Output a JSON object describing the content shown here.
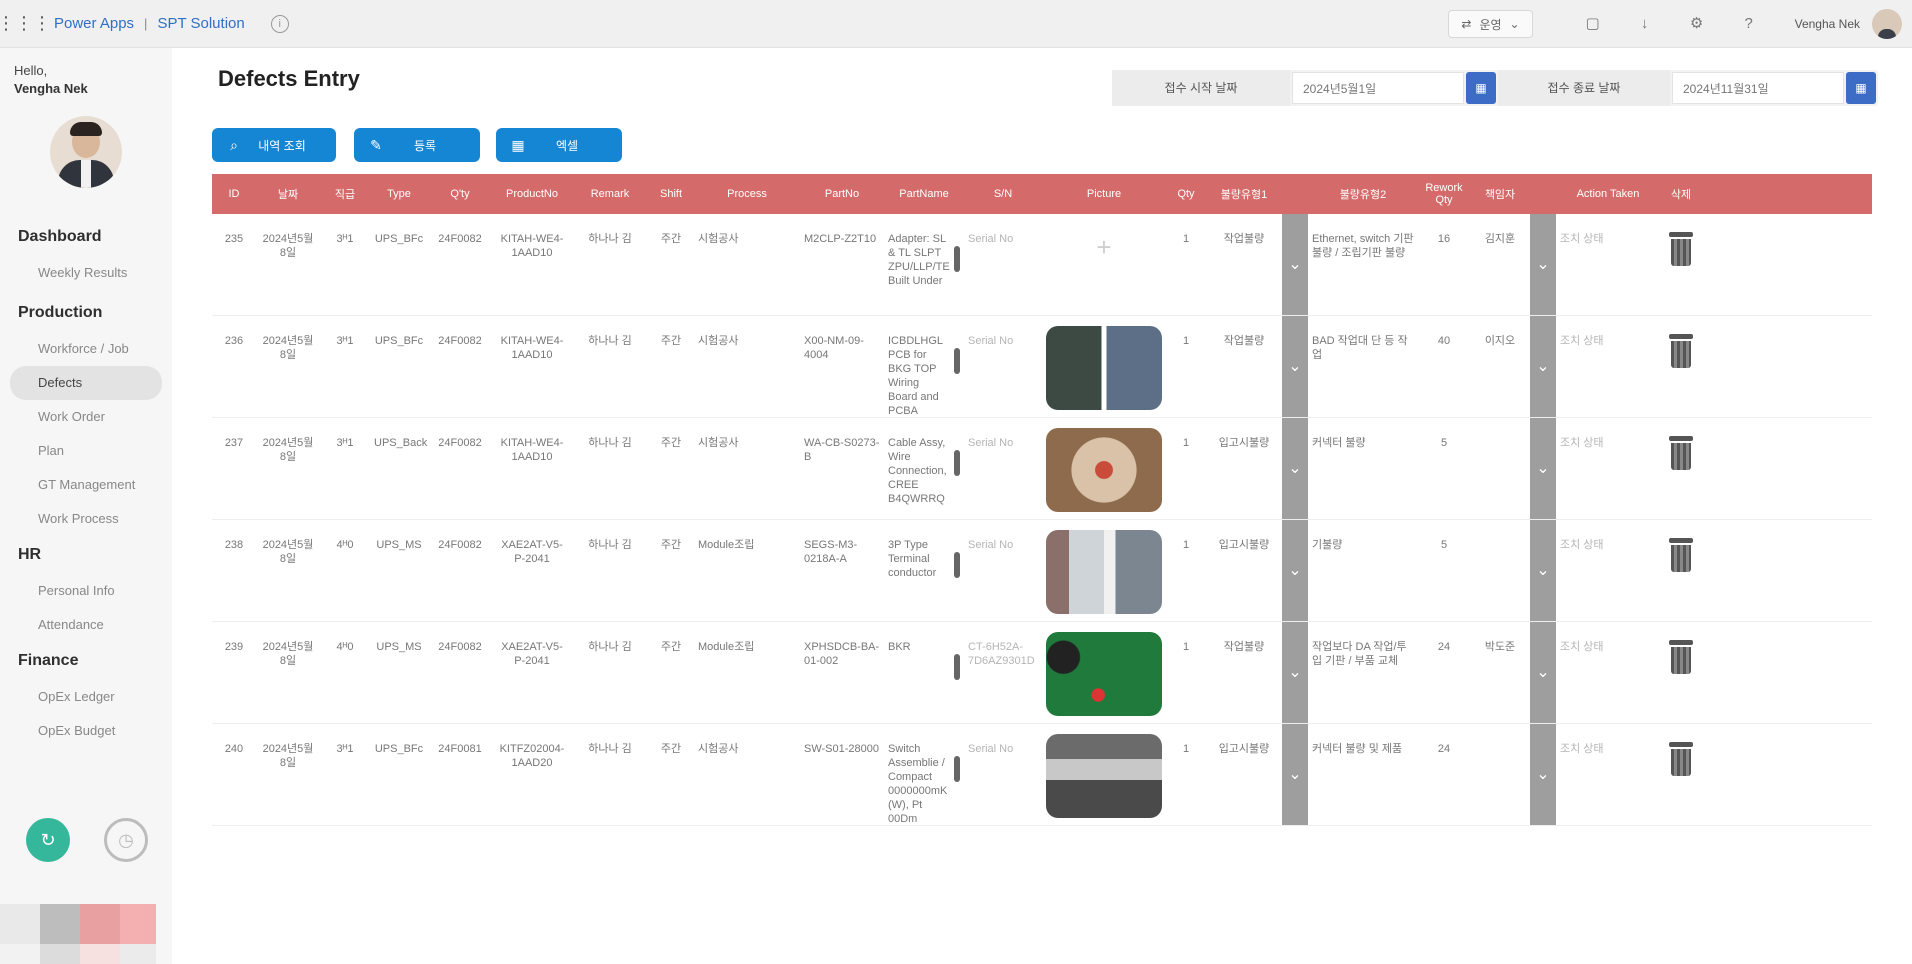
{
  "topbar": {
    "app_title": "Power Apps",
    "separator": "|",
    "solution_name": "SPT Solution",
    "environment": "운영",
    "user_name": "Vengha Nek"
  },
  "sidebar": {
    "greeting": "Hello,",
    "user_name": "Vengha Nek",
    "sections": [
      {
        "title": "Dashboard",
        "items": [
          "Weekly Results"
        ]
      },
      {
        "title": "Production",
        "items": [
          "Workforce / Job",
          "Defects",
          "Work Order",
          "Plan",
          "GT Management",
          "Work Process"
        ]
      },
      {
        "title": "HR",
        "items": [
          "Personal Info",
          "Attendance"
        ]
      },
      {
        "title": "Finance",
        "items": [
          "OpEx Ledger",
          "OpEx Budget"
        ]
      }
    ],
    "active_item": "Defects"
  },
  "page": {
    "title": "Defects Entry",
    "start_date_label": "접수 시작 날짜",
    "start_date_value": "2024년5월1일",
    "end_date_label": "접수 종료 날짜",
    "end_date_value": "2024년11월31일",
    "buttons": {
      "search": "내역 조회",
      "register": "등록",
      "excel": "엑셀"
    }
  },
  "table": {
    "columns": [
      "ID",
      "날짜",
      "직급",
      "Type",
      "Q'ty",
      "ProductNo",
      "Remark",
      "Shift",
      "Process",
      "PartNo",
      "PartName",
      "S/N",
      "Picture",
      "Qty",
      "불량유형1",
      "",
      "불량유형2",
      "Rework Qty",
      "책임자",
      "",
      "Action Taken",
      "삭제"
    ],
    "rows": [
      {
        "id": "235",
        "date": "2024년5월8일",
        "grade": "3ᴴ1",
        "type": "UPS_BFc",
        "qty": "24F0082",
        "product_no": "KITAH-WE4-1AAD10",
        "remark": "하나나 김",
        "shift": "주간",
        "process": "시험공사",
        "part_no": "M2CLP-Z2T10",
        "part_name": "Adapter: SL & TL SLPT ZPU/LLP/TEST/Scale-Built Under",
        "sn": "Serial No",
        "picture": "",
        "count": "1",
        "defect1": "작업불량",
        "defect2": "Ethernet, switch 기판 불량 / 조립기판 불량",
        "rework": "16",
        "owner": "김지훈",
        "action": "조치 상태"
      },
      {
        "id": "236",
        "date": "2024년5월8일",
        "grade": "3ᴴ1",
        "type": "UPS_BFc",
        "qty": "24F0082",
        "product_no": "KITAH-WE4-1AAD10",
        "remark": "하나나 김",
        "shift": "주간",
        "process": "시험공사",
        "part_no": "X00-NM-09-4004",
        "part_name": "ICBDLHGL PCB for BKG TOP Wiring Board and PCBA",
        "sn": "Serial No",
        "picture": "photo1",
        "count": "1",
        "defect1": "작업불량",
        "defect2": "BAD 작업대 단 등 작업",
        "rework": "40",
        "owner": "이지오",
        "action": "조치 상태"
      },
      {
        "id": "237",
        "date": "2024년5월8일",
        "grade": "3ᴴ1",
        "type": "UPS_Back",
        "qty": "24F0082",
        "product_no": "KITAH-WE4-1AAD10",
        "remark": "하나나 김",
        "shift": "주간",
        "process": "시험공사",
        "part_no": "WA-CB-S0273-B",
        "part_name": "Cable Assy, Wire Connection, CREE B4QWRRQ",
        "sn": "Serial No",
        "picture": "photo2",
        "count": "1",
        "defect1": "입고시불량",
        "defect2": "커넥터 불량",
        "rework": "5",
        "owner": "",
        "action": "조치 상태"
      },
      {
        "id": "238",
        "date": "2024년5월8일",
        "grade": "4ᴴ0",
        "type": "UPS_MS",
        "qty": "24F0082",
        "product_no": "XAE2AT-V5-P-2041",
        "remark": "하나나 김",
        "shift": "주간",
        "process": "Module조립",
        "part_no": "SEGS-M3-0218A-A",
        "part_name": "3P Type Terminal conductor",
        "sn": "Serial No",
        "picture": "photo3",
        "count": "1",
        "defect1": "입고시불량",
        "defect2": "기불량",
        "rework": "5",
        "owner": "",
        "action": "조치 상태"
      },
      {
        "id": "239",
        "date": "2024년5월8일",
        "grade": "4ᴴ0",
        "type": "UPS_MS",
        "qty": "24F0082",
        "product_no": "XAE2AT-V5-P-2041",
        "remark": "하나나 김",
        "shift": "주간",
        "process": "Module조립",
        "part_no": "XPHSDCB-BA-01-002",
        "part_name": "BKR",
        "sn": "CT-6H52A-7D6AZ9301D",
        "picture": "photo4",
        "count": "1",
        "defect1": "작업불량",
        "defect2": "작업보다 DA 작업/투입 기판 / 부품 교체",
        "rework": "24",
        "owner": "박도준",
        "action": "조치 상태"
      },
      {
        "id": "240",
        "date": "2024년5월8일",
        "grade": "3ᴴ1",
        "type": "UPS_BFc",
        "qty": "24F0081",
        "product_no": "KITFZ02004-1AAD20",
        "remark": "하나나 김",
        "shift": "주간",
        "process": "시험공사",
        "part_no": "SW-S01-28000",
        "part_name": "Switch Assemblie / Compact 0000000mK (W), Pt 00Dm",
        "sn": "Serial No",
        "picture": "photo5",
        "count": "1",
        "defect1": "입고시불량",
        "defect2": "커넥터 불량 및 제품",
        "rework": "24",
        "owner": "",
        "action": "조치 상태"
      }
    ]
  },
  "colors": {
    "header_red": "#d46a6a",
    "button_blue": "#1486d4",
    "date_button": "#3d6cc7",
    "accent_green": "#34b79a"
  }
}
